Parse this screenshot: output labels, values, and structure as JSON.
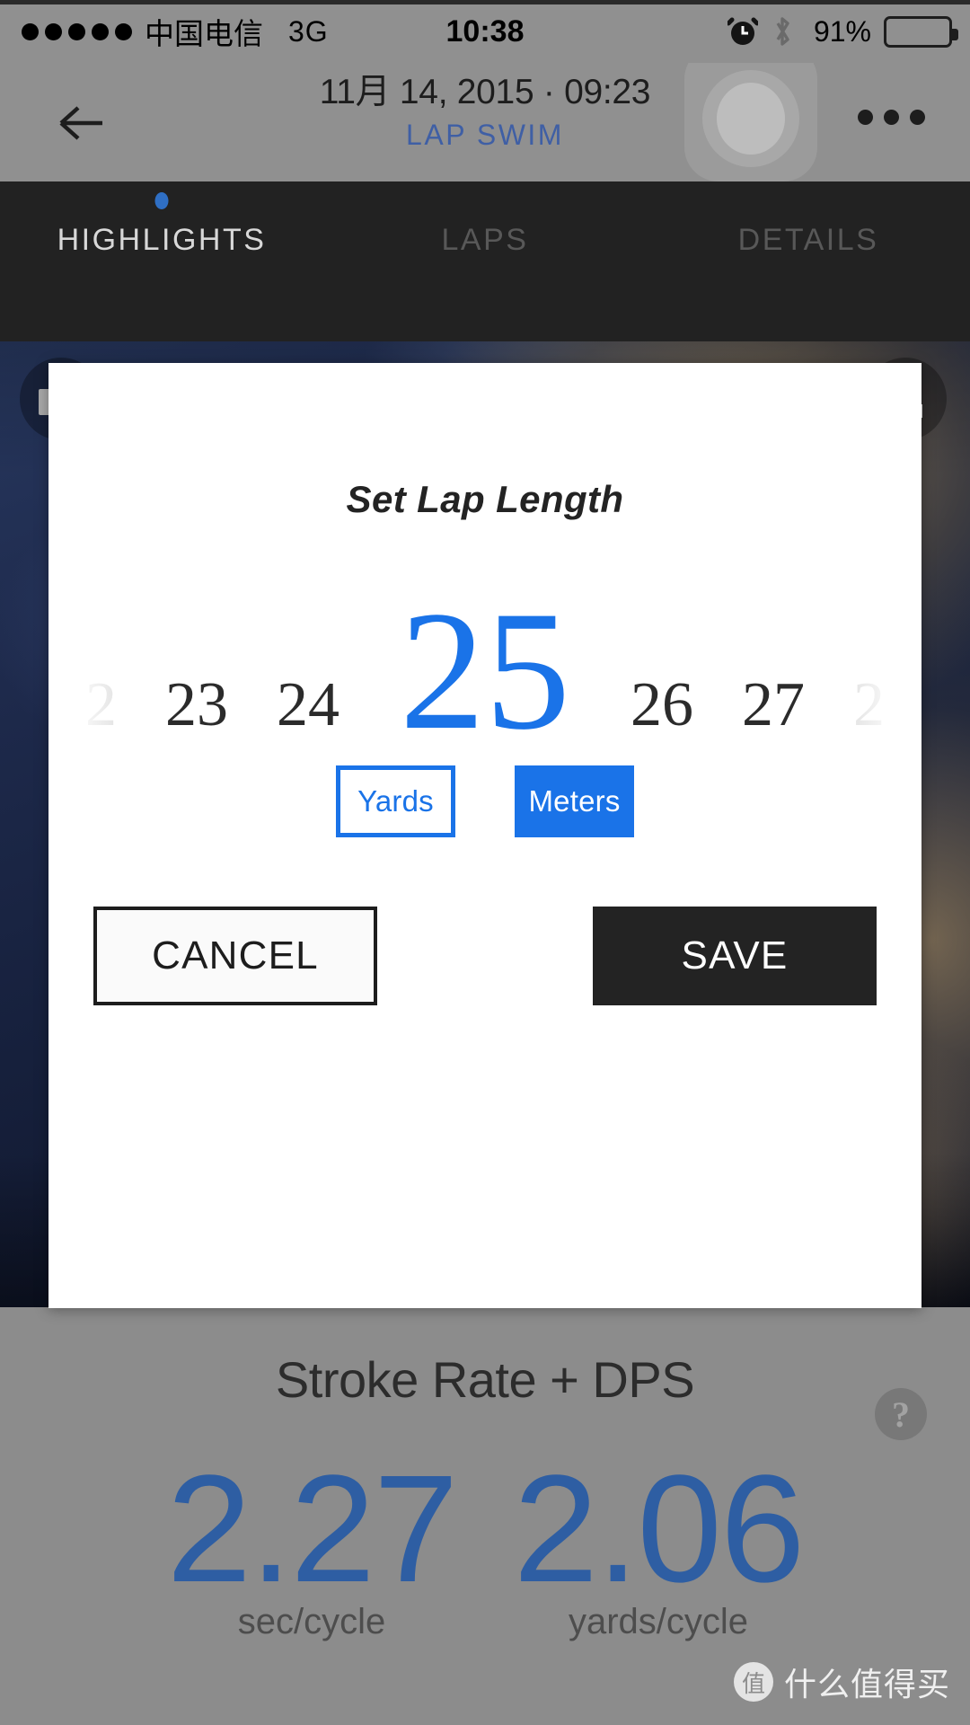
{
  "status_bar": {
    "signal_dots": 5,
    "carrier": "中国电信",
    "network": "3G",
    "clock": "10:38",
    "battery_percent": "91%",
    "alarm_icon": "alarm-clock-icon",
    "bluetooth_icon": "bluetooth-icon"
  },
  "nav": {
    "back_icon": "back-arrow-icon",
    "date": "11月 14, 2015 · 09:23",
    "subtitle": "LAP SWIM",
    "more_icon": "more-options-icon"
  },
  "tabs": [
    {
      "label": "HIGHLIGHTS",
      "active": true
    },
    {
      "label": "LAPS",
      "active": false
    },
    {
      "label": "DETAILS",
      "active": false
    }
  ],
  "photo": {
    "camera_icon": "camera-icon",
    "share_icon": "share-upload-icon"
  },
  "dialog": {
    "title": "Set Lap Length",
    "picker": {
      "values": [
        "2",
        "23",
        "24",
        "25",
        "26",
        "27",
        "2"
      ],
      "selected": "25",
      "selected_index": 3
    },
    "units": [
      {
        "label": "Yards",
        "selected": false
      },
      {
        "label": "Meters",
        "selected": true
      }
    ],
    "cancel_label": "CANCEL",
    "save_label": "SAVE"
  },
  "bottom": {
    "heading": "Stroke Rate + DPS",
    "help_icon": "help-question-icon",
    "stats": [
      {
        "value": "2.27",
        "unit": "sec/cycle"
      },
      {
        "value": "2.06",
        "unit": "yards/cycle"
      }
    ]
  },
  "watermark": {
    "logo": "值",
    "text": "什么值得买"
  },
  "colors": {
    "accent_blue": "#1a73e8",
    "stat_blue": "#2e5ea3",
    "subtitle_blue": "#3f5fa5",
    "tab_bar_bg": "#222222",
    "save_bg": "#232323",
    "panel_grey": "#8c8c8c"
  }
}
